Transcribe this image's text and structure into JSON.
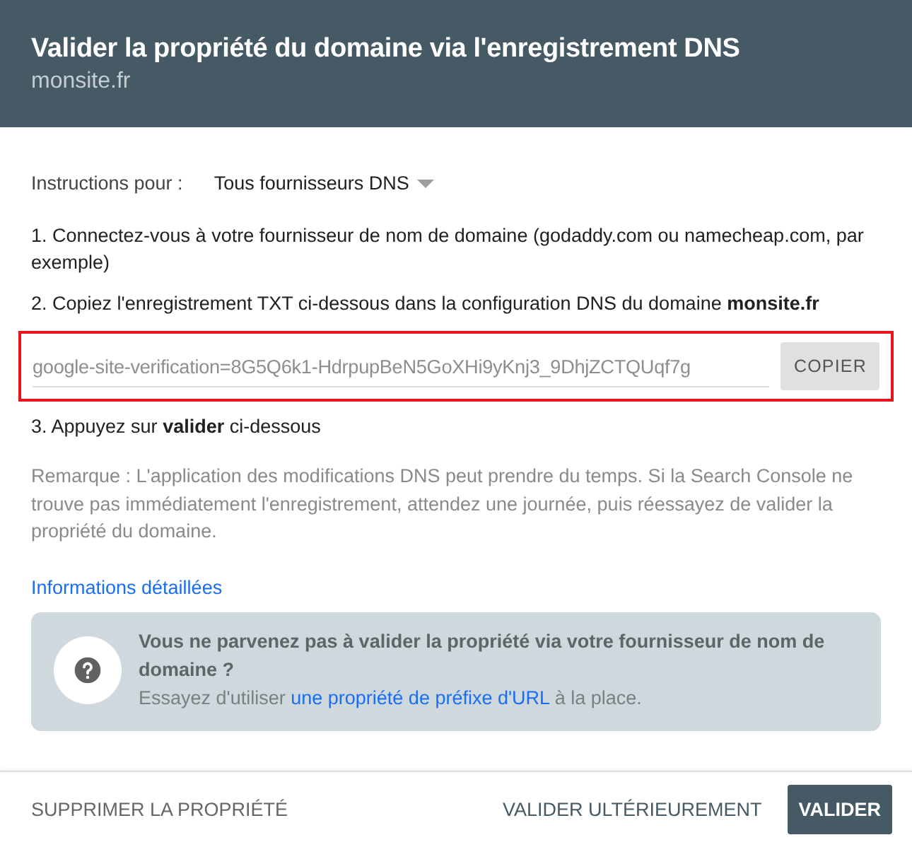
{
  "header": {
    "title": "Valider la propriété du domaine via l'enregistrement DNS",
    "subtitle": "monsite.fr"
  },
  "instructions": {
    "label": "Instructions pour :",
    "provider": "Tous fournisseurs DNS"
  },
  "steps_before": [
    "1. Connectez-vous à votre fournisseur de nom de domaine (godaddy.com ou namecheap.com, par exemple)",
    "2. Copiez l'enregistrement TXT ci-dessous dans la configuration DNS du domaine **monsite.fr**"
  ],
  "record": {
    "value": "google-site-verification=8G5Q6k1-HdrpupBeN5GoXHi9yKnj3_9DhjZCTQUqf7g",
    "button": "COPIER"
  },
  "step_after": "3. Appuyez sur **valider** ci-dessous",
  "note": "Remarque : L'application des modifications DNS peut prendre du temps. Si la Search Console ne trouve pas immédiatement l'enregistrement, attendez une journée, puis réessayez de valider la propriété du domaine.",
  "details_link": "Informations détaillées",
  "help": {
    "title": "Vous ne parvenez pas à valider la propriété via votre fournisseur de nom de domaine ?",
    "text_before": "Essayez d'utiliser",
    "link": "une propriété de préfixe d'URL",
    "text_after": "à la place."
  },
  "footer": {
    "delete": "SUPPRIMER LA PROPRIÉTÉ",
    "later": "VALIDER ULTÉRIEUREMENT",
    "validate": "VALIDER"
  }
}
